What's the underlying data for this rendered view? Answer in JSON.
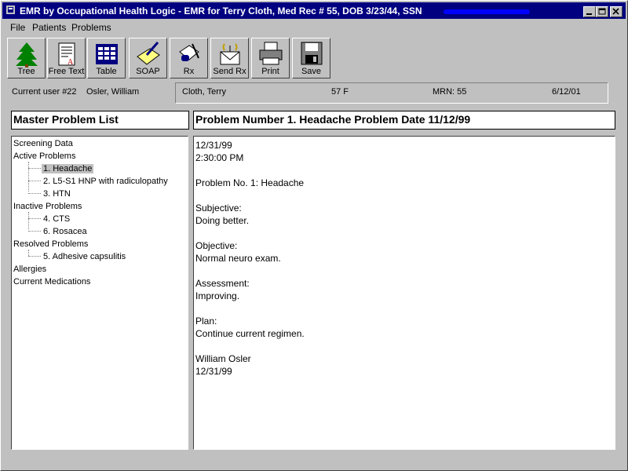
{
  "window": {
    "title": "EMR by Occupational Health Logic - EMR for Terry Cloth, Med Rec # 55, DOB 3/23/44, SSN"
  },
  "menu": {
    "file": "File",
    "patients": "Patients",
    "problems": "Problems"
  },
  "toolbar": {
    "tree": "Tree",
    "free_text": "Free Text",
    "table": "Table",
    "soap": "SOAP",
    "rx": "Rx",
    "send_rx": "Send Rx",
    "print": "Print",
    "save": "Save"
  },
  "status": {
    "current_user": "Current user #22",
    "user_name": "Osler, William"
  },
  "patient": {
    "name": "Cloth, Terry",
    "age_sex": "57 F",
    "mrn": "MRN: 55",
    "date": "6/12/01"
  },
  "headers": {
    "master_list": "Master Problem List",
    "problem": "Problem Number 1. Headache   Problem Date 11/12/99"
  },
  "tree": {
    "screening": "Screening Data",
    "active": "Active Problems",
    "active_items": [
      "1. Headache",
      "2. L5-S1 HNP with radiculopathy",
      "3. HTN"
    ],
    "inactive": "Inactive Problems",
    "inactive_items": [
      "4. CTS",
      "6. Rosacea"
    ],
    "resolved": "Resolved Problems",
    "resolved_items": [
      "5. Adhesive capsulitis"
    ],
    "allergies": "Allergies",
    "medications": "Current Medications"
  },
  "note": {
    "date": "12/31/99",
    "time": "2:30:00 PM",
    "problem": "Problem No. 1:  Headache",
    "subjective_label": "Subjective:",
    "subjective": "Doing better.",
    "objective_label": "Objective:",
    "objective": "Normal neuro exam.",
    "assessment_label": "Assessment:",
    "assessment": "Improving.",
    "plan_label": "Plan:",
    "plan": "Continue current regimen.",
    "signature": "William Osler",
    "sign_date": "12/31/99"
  }
}
